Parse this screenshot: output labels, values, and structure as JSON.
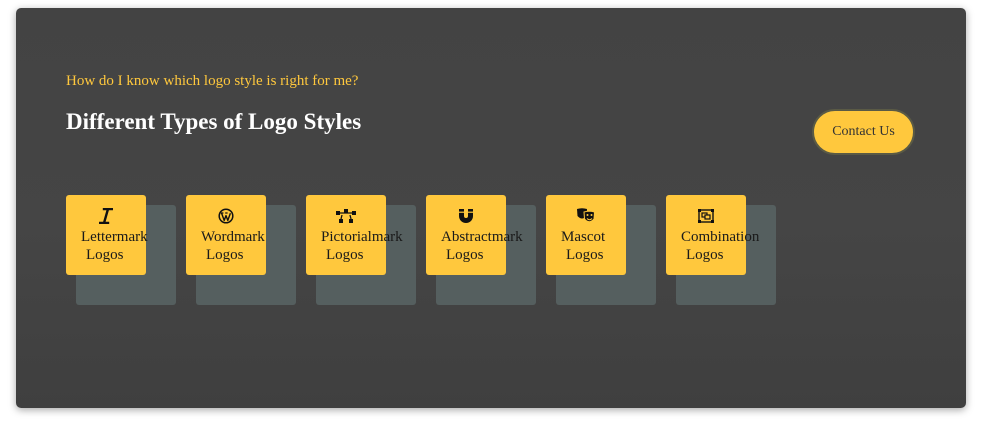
{
  "header": {
    "eyebrow": "How do I know which logo style is right for me?",
    "title": "Different Types of Logo Styles",
    "contact_label": "Contact Us"
  },
  "colors": {
    "accent": "#ffc83d",
    "panel": "#444444",
    "card_shadow": "#555f5f",
    "title": "#ffffff"
  },
  "cards": [
    {
      "icon": "italic-text-icon",
      "line1": "Lettermark",
      "line2": "Logos"
    },
    {
      "icon": "wordpress-icon",
      "line1": "Wordmark",
      "line2": "Logos"
    },
    {
      "icon": "vector-nodes-icon",
      "line1": "Pictorialmark",
      "line2": "Logos"
    },
    {
      "icon": "magnet-icon",
      "line1": "Abstractmark",
      "line2": "Logos"
    },
    {
      "icon": "theater-masks-icon",
      "line1": "Mascot",
      "line2": "Logos"
    },
    {
      "icon": "object-group-icon",
      "line1": "Combination",
      "line2": "Logos"
    }
  ]
}
